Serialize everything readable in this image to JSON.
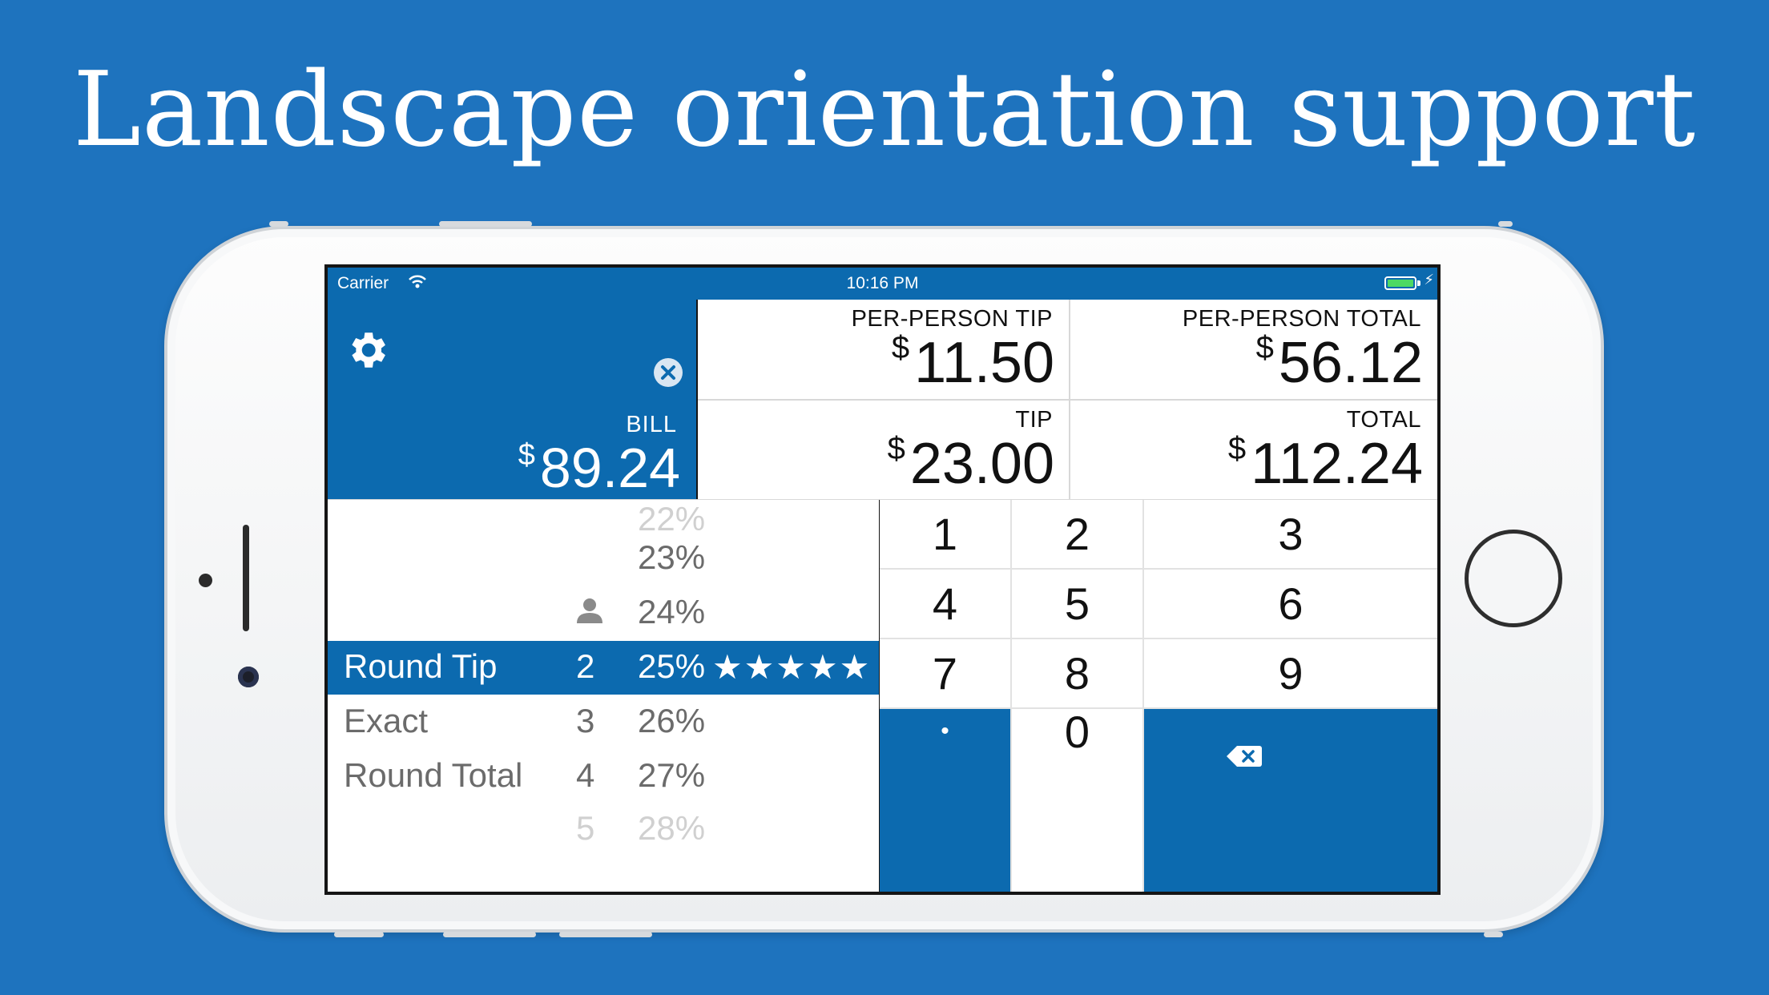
{
  "headline": "Landscape orientation support",
  "status_bar": {
    "carrier": "Carrier",
    "time": "10:16 PM"
  },
  "bill": {
    "label": "BILL",
    "currency": "$",
    "amount": "89.24"
  },
  "results": {
    "per_person_tip": {
      "label": "PER-PERSON TIP",
      "currency": "$",
      "amount": "11.50"
    },
    "per_person_total": {
      "label": "PER-PERSON TOTAL",
      "currency": "$",
      "amount": "56.12"
    },
    "tip": {
      "label": "TIP",
      "currency": "$",
      "amount": "23.00"
    },
    "total": {
      "label": "TOTAL",
      "currency": "$",
      "amount": "112.24"
    }
  },
  "picker": {
    "rows": [
      {
        "name": "",
        "count": "",
        "percent": "22%",
        "stars": ""
      },
      {
        "name": "",
        "count": "",
        "percent": "23%",
        "stars": ""
      },
      {
        "name": "",
        "count": "",
        "percent": "24%",
        "stars": ""
      },
      {
        "name": "Round Tip",
        "count": "2",
        "percent": "25%",
        "stars": "★★★★★"
      },
      {
        "name": "Exact",
        "count": "3",
        "percent": "26%",
        "stars": ""
      },
      {
        "name": "Round Total",
        "count": "4",
        "percent": "27%",
        "stars": ""
      },
      {
        "name": "",
        "count": "5",
        "percent": "28%",
        "stars": ""
      }
    ]
  },
  "keypad": {
    "keys": [
      "1",
      "2",
      "3",
      "4",
      "5",
      "6",
      "7",
      "8",
      "9",
      "•",
      "0",
      "backspace"
    ],
    "backspace_icon": "backspace-icon"
  },
  "colors": {
    "background": "#1e73be",
    "app_blue": "#0c6aaf",
    "battery_green": "#4cd964"
  }
}
